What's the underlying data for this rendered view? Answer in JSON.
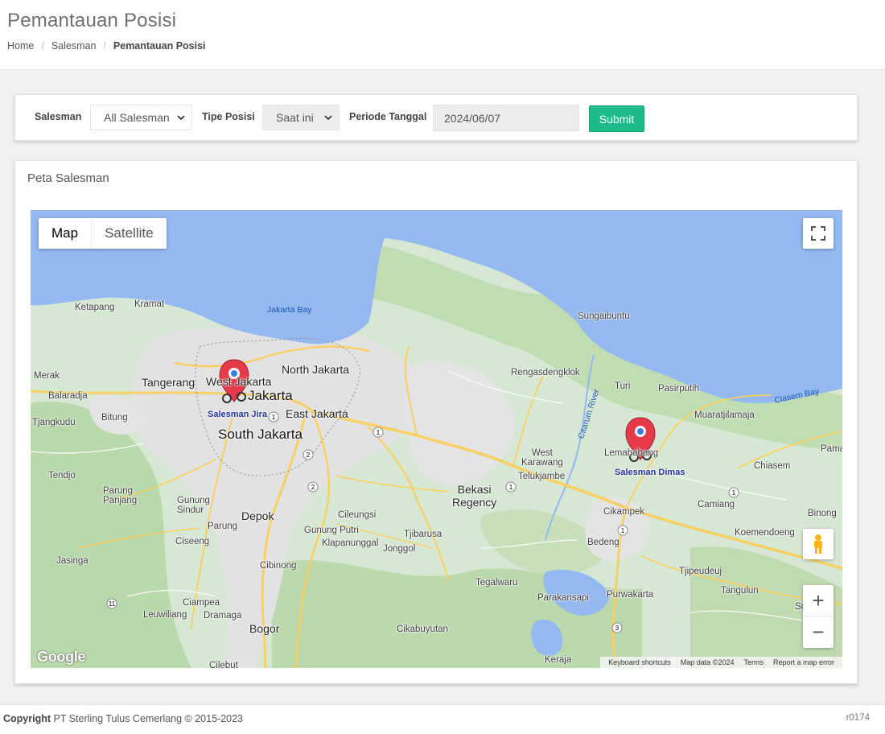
{
  "page": {
    "title": "Pemantauan Posisi",
    "breadcrumb": [
      "Home",
      "Salesman",
      "Pemantauan Posisi"
    ]
  },
  "filters": {
    "salesman_label": "Salesman",
    "salesman_value": "All Salesman",
    "tipe_label": "Tipe Posisi",
    "tipe_value": "Saat ini",
    "periode_label": "Periode Tanggal",
    "periode_value": "2024/06/07",
    "submit_label": "Submit"
  },
  "map_panel": {
    "title": "Peta Salesman",
    "map_types": [
      "Map",
      "Satellite"
    ],
    "active_map_type": "Map",
    "zoom_in": "+",
    "zoom_out": "−",
    "google": "Google",
    "attribution": [
      "Keyboard shortcuts",
      "Map data ©2024",
      "Terms",
      "Report a map error"
    ],
    "markers": [
      {
        "name": "Salesman Jira",
        "icon": "motorcycle-pin-icon"
      },
      {
        "name": "Salesman Dimas",
        "icon": "motorcycle-pin-icon"
      }
    ],
    "places": {
      "ketapang": "Ketapang",
      "kramat": "Kramat",
      "jakarta_bay": "Jakarta Bay",
      "sungaibuntu": "Sungaibuntu",
      "merak": "Merak",
      "tangerang": "Tangerang",
      "west_jakarta": "West Jakarta",
      "north_jakarta": "North Jakarta",
      "jakarta": "Jakarta",
      "balaradja": "Balaradja",
      "bitung": "Bitung",
      "east_jakarta": "East Jakarta",
      "tjangkudu": "Tjangkudu",
      "south_jakarta": "South Jakarta",
      "rengasdengklok": "Rengasdengklok",
      "turi": "Turi",
      "pasirputih": "Pasirputih",
      "ciasem_bay": "Ciasem Bay",
      "muaratjilamaja": "Muaratjilamaja",
      "citarum_river": "Citarum River",
      "lemahabang": "Lemahabang",
      "west_karawang": "West\nKarawang",
      "telukjambe": "Telukjambe",
      "pama": "Pama",
      "chiasem": "Chiasem",
      "tendjo": "Tendjo",
      "parung_panjang": "Parung\nPanjang",
      "gunung_sindur": "Gunung\nSindur",
      "depok": "Depok",
      "bekasi_regency": "Bekasi\nRegency",
      "cileungsi": "Cileungsi",
      "cikampek": "Cikampek",
      "camiang": "Camiang",
      "binong": "Binong",
      "parung": "Parung",
      "gunung_putri": "Gunung Putri",
      "tjibarusa": "Tjibarusa",
      "ciseeng": "Ciseeng",
      "klapanunggal": "Klapanunggal",
      "jonggol": "Jonggol",
      "bedeng": "Bedeng",
      "koemendoeng": "Koemendoeng",
      "jasinga": "Jasinga",
      "cibinong": "Cibinong",
      "tjipeudeuj": "Tjipeudeuj",
      "tegalwaru": "Tegalwaru",
      "tangulun": "Tangulun",
      "ciampea": "Ciampea",
      "leuwiliang": "Leuwiliang",
      "dramaga": "Dramaga",
      "parakansapi": "Parakansapi",
      "purwakarta": "Purwakarta",
      "bogor": "Bogor",
      "cikabuyutan": "Cikabuyutan",
      "keraja": "Keraja",
      "cilebut": "Cilebut",
      "su": "Su"
    },
    "colors": {
      "sea": "#94b8f0",
      "land": "#d6e8d3",
      "forest": "#b5d6a8",
      "urban": "#e4e4e4",
      "road": "#f8cf62",
      "marker": "#e53a4a"
    }
  },
  "footer": {
    "copyright_bold": "Copyright",
    "copyright_rest": " PT Sterling Tulus Cemerlang © 2015-2023",
    "version": "r0174"
  }
}
